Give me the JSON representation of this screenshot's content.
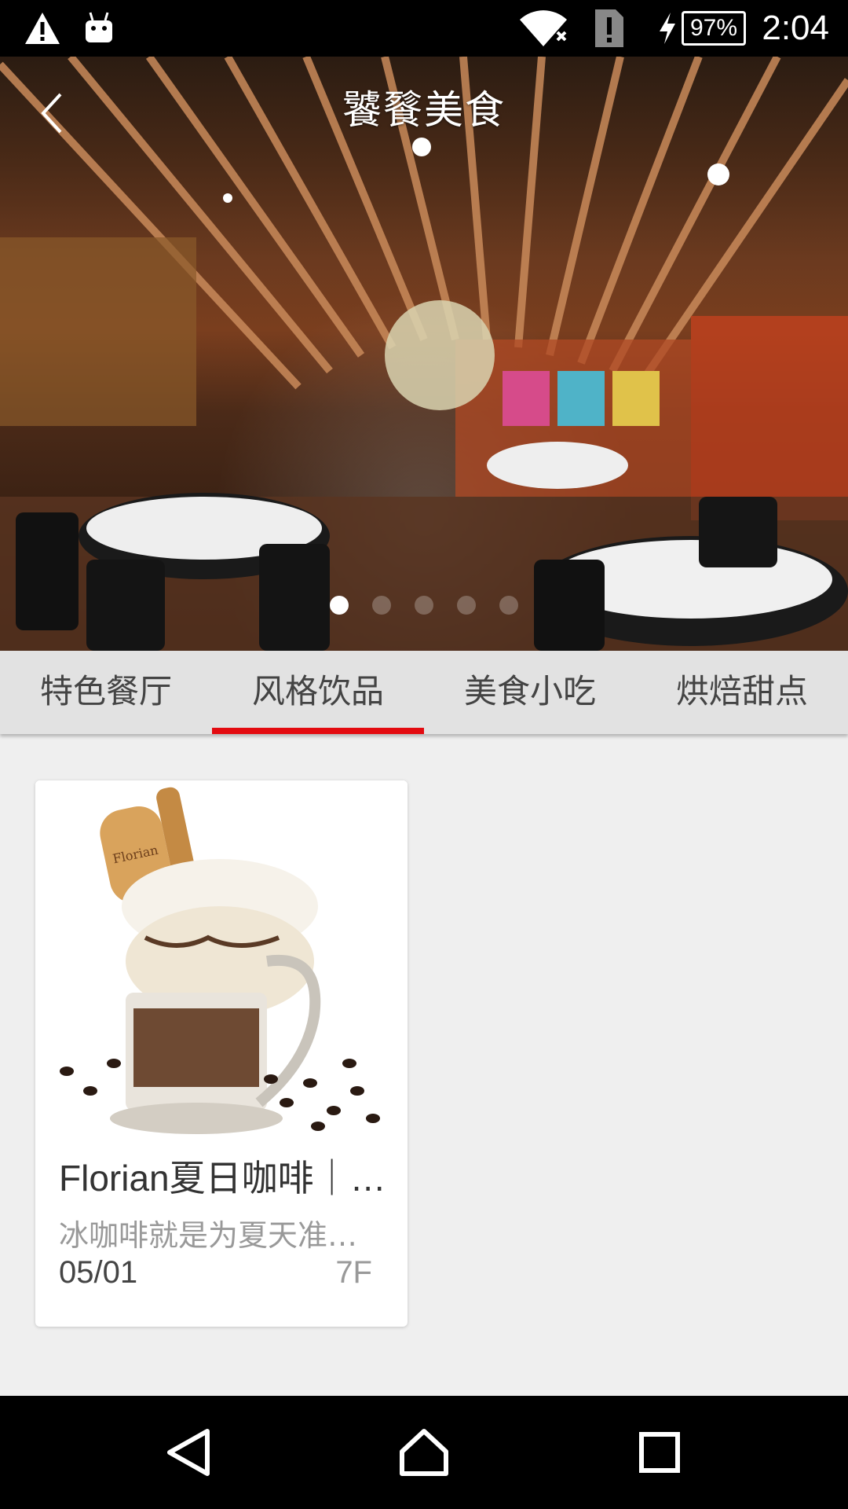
{
  "status_bar": {
    "time": "2:04",
    "battery": "97%",
    "icons": [
      "warning-icon",
      "android-icon",
      "wifi-icon",
      "sim-alert-icon",
      "charging-icon",
      "battery-icon"
    ]
  },
  "header": {
    "title": "饕餮美食",
    "back_icon": "chevron-left-icon"
  },
  "carousel": {
    "total": 5,
    "active": 1
  },
  "tabs": [
    {
      "label": "特色餐厅",
      "active": false
    },
    {
      "label": "风格饮品",
      "active": true
    },
    {
      "label": "美食小吃",
      "active": false
    },
    {
      "label": "烘焙甜点",
      "active": false
    }
  ],
  "cards": [
    {
      "title": "Florian夏日咖啡｜…",
      "description": "冰咖啡就是为夏天准…",
      "date": "05/01",
      "floor": "7F"
    }
  ],
  "nav_bar": {
    "buttons": [
      "back-triangle-icon",
      "home-icon",
      "recents-icon"
    ]
  },
  "colors": {
    "accent": "#e30b10",
    "background": "#efefef",
    "status_bar": "#000000"
  }
}
